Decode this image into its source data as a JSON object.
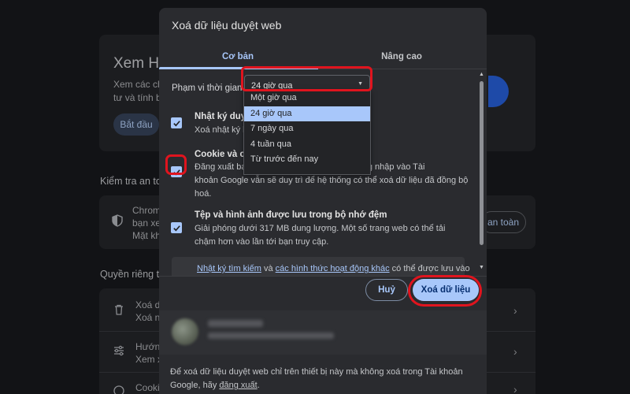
{
  "background": {
    "header_title": "Xem Hư",
    "header_desc_1": "Xem các chế",
    "header_desc_2": "tư và tính bả",
    "start_button": "Bắt đầu",
    "safety_section": "Kiểm tra an to",
    "chrome_line": "Chrom",
    "chrome_line_2": "bạn xe",
    "chrome_line_3": "Mặt kh",
    "safety_button": "an toàn",
    "privacy_section": "Quyền riêng tư",
    "item1_line1": "Xoá dữ",
    "item1_line2": "Xoá n",
    "item2_line1": "Hướng",
    "item2_line2": "Xem x",
    "item3_line1": "Cooki"
  },
  "dialog": {
    "title": "Xoá dữ liệu duyệt web",
    "tabs": [
      {
        "label": "Cơ bản",
        "active": true
      },
      {
        "label": "Nâng cao",
        "active": false
      }
    ],
    "time_range": {
      "label": "Phạm vi thời gian",
      "selected": "24 giờ qua",
      "options": [
        "Một giờ qua",
        "24 giờ qua",
        "7 ngày qua",
        "4 tuần qua",
        "Từ trước đến nay"
      ]
    },
    "options": [
      {
        "title": "Nhật ký duyệt",
        "desc": "Xoá nhật ký k",
        "checked": true
      },
      {
        "title": "Cookie và các",
        "desc_line1": "Đăng xuất bạ",
        "desc_line1_rest": "ng thái đăng nhập vào Tài",
        "desc_line2": "khoản Google vẫn sẽ duy trì để hệ thống có thể xoá dữ liệu đã đồng bộ",
        "desc_line3": "hoá.",
        "checked": true
      },
      {
        "title": "Tệp và hình ảnh được lưu trong bộ nhớ đệm",
        "desc": "Giải phóng dưới 317 MB dung lượng. Một số trang web có thể tải chậm hơn vào lần tới bạn truy cập.",
        "checked": true
      }
    ],
    "info": {
      "link1": "Nhật ký tìm kiếm",
      "and": " và ",
      "link2": "các hình thức hoạt động khác",
      "rest": " có thể được lưu vào"
    },
    "cancel_label": "Huỷ",
    "delete_label": "Xoá dữ liệu",
    "footer": {
      "text": "Để xoá dữ liệu duyệt web chỉ trên thiết bị này mà không xoá trong Tài khoản Google, hãy ",
      "link": "đăng xuất",
      "end": "."
    }
  },
  "colors": {
    "accent": "#a8c7fa",
    "dialog_bg": "#2a2b2f",
    "page_bg": "#121316",
    "highlight": "#e0141e"
  }
}
